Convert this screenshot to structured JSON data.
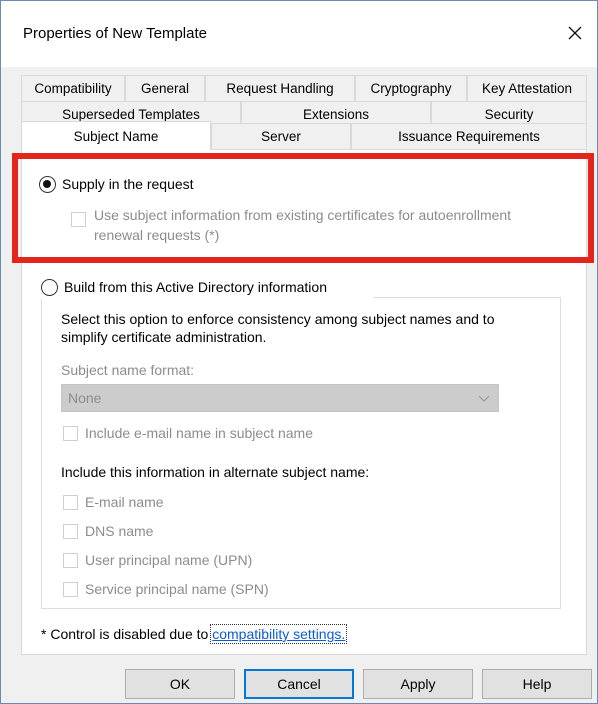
{
  "window": {
    "title": "Properties of New Template",
    "close_icon": "close-icon"
  },
  "tabs": {
    "row1": [
      "Compatibility",
      "General",
      "Request Handling",
      "Cryptography",
      "Key Attestation"
    ],
    "row2": [
      "Superseded Templates",
      "Extensions",
      "Security"
    ],
    "row3": [
      "Subject Name",
      "Server",
      "Issuance Requirements"
    ],
    "active": "Subject Name"
  },
  "supply": {
    "label": "Supply in the request",
    "checked": true,
    "checkbox_line1": "Use subject information from existing certificates for autoenrollment",
    "checkbox_line2": "renewal requests (*)"
  },
  "build": {
    "label": "Build from this Active Directory information",
    "checked": false,
    "desc_line1": "Select this option to enforce consistency among subject names and to",
    "desc_line2": "simplify certificate administration.",
    "format_label": "Subject name format:",
    "format_value": "None",
    "include_email": "Include e-mail name in subject name",
    "alt_heading": "Include this information in alternate subject name:",
    "alt_options": [
      "E-mail name",
      "DNS name",
      "User principal name (UPN)",
      "Service principal name (SPN)"
    ]
  },
  "note": {
    "text": "* Control is disabled due to ",
    "link": "compatibility settings."
  },
  "buttons": {
    "ok": "OK",
    "cancel": "Cancel",
    "apply": "Apply",
    "help": "Help"
  },
  "colors": {
    "highlight_frame": "#e3261b",
    "link": "#0a5bd6",
    "default_button": "#0078d7"
  }
}
